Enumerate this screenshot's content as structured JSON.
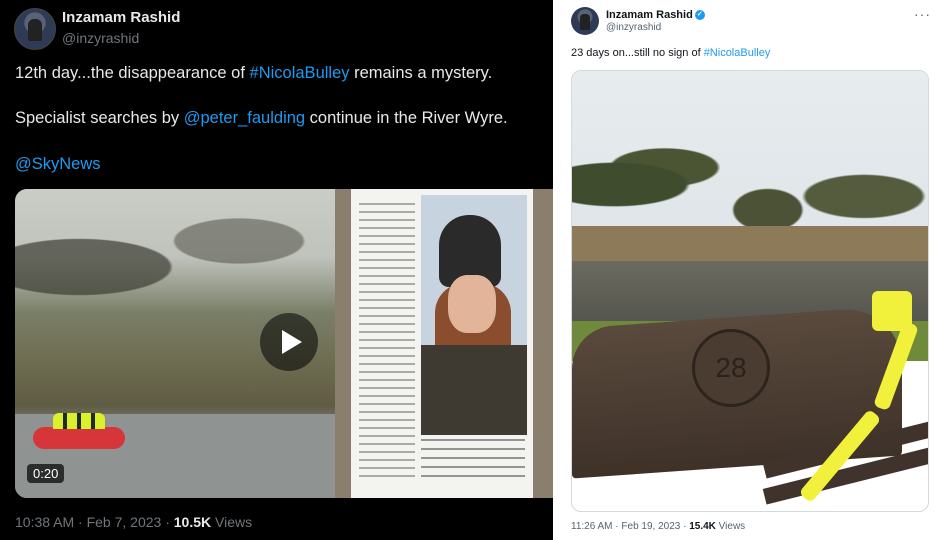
{
  "left_tweet": {
    "author_name": "Inzamam Rashid",
    "author_handle": "@inzyrashid",
    "line1_prefix": "12th day...the disappearance of ",
    "line1_hashtag": "#NicolaBulley",
    "line1_suffix": " remains a mystery.",
    "line2_prefix": "Specialist searches by ",
    "line2_mention": "@peter_faulding",
    "line2_suffix": " continue in the River Wyre.",
    "line3_mention": "@SkyNews",
    "video_duration": "0:20",
    "timestamp": "10:38 AM · Feb 7, 2023 · ",
    "views_count": "10.5K",
    "views_label": " Views"
  },
  "right_tweet": {
    "author_name": "Inzamam Rashid",
    "author_handle": "@inzyrashid",
    "text_prefix": "23 days on...still no sign of ",
    "text_hashtag": "#NicolaBulley",
    "timestamp": "11:26 AM · Feb 19, 2023 · ",
    "views_count": "15.4K",
    "views_label": " Views",
    "bench_plaque": "28"
  },
  "icons": {
    "verified": "verified-badge-icon",
    "play": "play-icon",
    "more": "more-options-icon"
  },
  "colors": {
    "link": "#1d9bf0",
    "dark_bg": "#000000",
    "light_bg": "#ffffff"
  }
}
